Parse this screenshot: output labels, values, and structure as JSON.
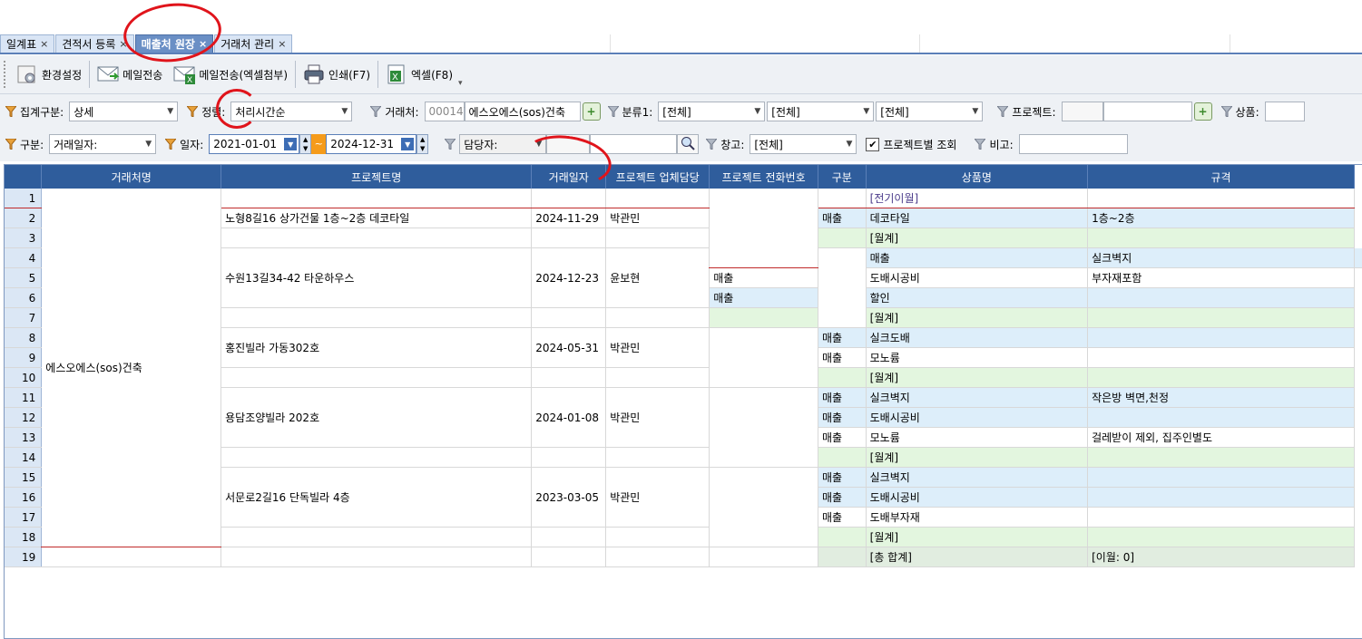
{
  "tabs": [
    {
      "label": "일계표",
      "active": false
    },
    {
      "label": "견적서 등록",
      "active": false
    },
    {
      "label": "매출처 원장",
      "active": true
    },
    {
      "label": "거래처 관리",
      "active": false
    }
  ],
  "toolbar": {
    "settings": "환경설정",
    "mail": "메일전송",
    "mail_excel": "메일전송(엑셀첨부)",
    "print": "인쇄(F7)",
    "excel": "엑셀(F8)"
  },
  "filters": {
    "agg_label": "집계구분:",
    "agg_value": "상세",
    "sort_label": "정렬:",
    "sort_value": "처리시간순",
    "client_label": "거래처:",
    "client_code": "000147",
    "client_name": "에스오에스(sos)건축",
    "cat1_label": "분류1:",
    "cat1_value": "[전체]",
    "cat2_value": "[전체]",
    "cat3_value": "[전체]",
    "project_label": "프로젝트:",
    "product_label": "상품:",
    "type_label": "구분:",
    "type_value": "거래일자:",
    "date_label": "일자:",
    "date_from": "2021-01-01",
    "date_tilde": "~",
    "date_to": "2024-12-31",
    "manager_label": "담당자:",
    "warehouse_label": "창고:",
    "warehouse_value": "[전체]",
    "project_view_label": "프로젝트별 조회",
    "project_view_checked": true,
    "note_label": "비고:"
  },
  "grid": {
    "columns": [
      "",
      "거래처명",
      "프로젝트명",
      "거래일자",
      "프로젝트 업체담당",
      "프로젝트 전화번호",
      "구분",
      "상품명",
      "규격"
    ],
    "client_name": "에스오에스(sos)건축",
    "projects": [
      {
        "name": "노형8길16 상가건물 1층~2층 데코타일",
        "date": "2024-11-29",
        "manager": "박관민"
      },
      {
        "name": "수원13길34-42 타운하우스",
        "date": "2024-12-23",
        "manager": "윤보현"
      },
      {
        "name": "홍진빌라 가동302호",
        "date": "2024-05-31",
        "manager": "박관민"
      },
      {
        "name": "용담조양빌라 202호",
        "date": "2024-01-08",
        "manager": "박관민"
      },
      {
        "name": "서문로2길16 단독빌라 4층",
        "date": "2023-03-05",
        "manager": "박관민"
      }
    ],
    "rows": [
      {
        "n": "1",
        "kind": "",
        "product": "[전기이월]",
        "spec": "",
        "style": "white"
      },
      {
        "n": "2",
        "kind": "매출",
        "product": "데코타일",
        "spec": "1층~2층",
        "style": "blue"
      },
      {
        "n": "3",
        "kind": "",
        "product": "[월계]",
        "spec": "",
        "style": "green"
      },
      {
        "n": "4",
        "kind": "매출",
        "product": "실크벽지",
        "spec": "",
        "style": "blue"
      },
      {
        "n": "5",
        "kind": "매출",
        "product": "도배시공비",
        "spec": "부자재포함",
        "style": "white"
      },
      {
        "n": "6",
        "kind": "매출",
        "product": "할인",
        "spec": "",
        "style": "blue"
      },
      {
        "n": "7",
        "kind": "",
        "product": "[월계]",
        "spec": "",
        "style": "green"
      },
      {
        "n": "8",
        "kind": "매출",
        "product": "실크도배",
        "spec": "",
        "style": "blue"
      },
      {
        "n": "9",
        "kind": "매출",
        "product": "모노륨",
        "spec": "",
        "style": "white"
      },
      {
        "n": "10",
        "kind": "",
        "product": "[월계]",
        "spec": "",
        "style": "green"
      },
      {
        "n": "11",
        "kind": "매출",
        "product": "실크벽지",
        "spec": "작은방 벽면,천정",
        "style": "blue"
      },
      {
        "n": "12",
        "kind": "매출",
        "product": "도배시공비",
        "spec": "",
        "style": "blue"
      },
      {
        "n": "13",
        "kind": "매출",
        "product": "모노륨",
        "spec": "걸레받이 제외, 집주인별도",
        "style": "white"
      },
      {
        "n": "14",
        "kind": "",
        "product": "[월계]",
        "spec": "",
        "style": "green"
      },
      {
        "n": "15",
        "kind": "매출",
        "product": "실크벽지",
        "spec": "",
        "style": "blue"
      },
      {
        "n": "16",
        "kind": "매출",
        "product": "도배시공비",
        "spec": "",
        "style": "blue"
      },
      {
        "n": "17",
        "kind": "매출",
        "product": "도배부자재",
        "spec": "",
        "style": "white"
      },
      {
        "n": "18",
        "kind": "",
        "product": "[월계]",
        "spec": "",
        "style": "green"
      },
      {
        "n": "19",
        "kind": "",
        "product": "[총 합계]",
        "spec": "[이월: 0]",
        "style": "total"
      }
    ]
  },
  "colors": {
    "header": "#2f5d9c",
    "active_tab": "#6a8fc5",
    "annotation": "#e0141b"
  }
}
